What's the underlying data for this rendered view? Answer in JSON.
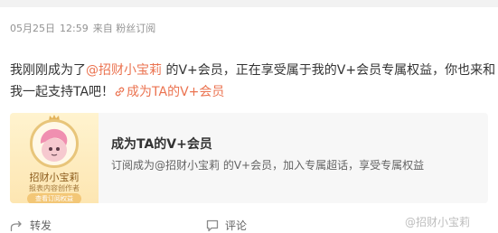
{
  "post": {
    "date": "05月25日",
    "time": "12:59",
    "source": "来自 粉丝订阅",
    "text": {
      "prefix": "我刚刚成为了",
      "mention": "@招财小宝莉",
      "middle": " 的V+会员，正在享受属于我的V+会员专属权益，你也来和",
      "line2": "我一起支持TA吧！",
      "link": "成为TA的V+会员"
    }
  },
  "card": {
    "title": "成为TA的V+会员",
    "description": "订阅成为@招财小宝莉 的V+会员，加入专属超话，享受专属权益",
    "thumb_name": "招财小宝莉",
    "thumb_tag": "报表内容创作者",
    "thumb_button": "查看订阅权益"
  },
  "actions": {
    "repost": "转发",
    "comment": "评论"
  },
  "watermark": "@招财小宝莉",
  "colors": {
    "accent": "#eb7350",
    "meta": "#939393",
    "card_bg": "#f7f7f7"
  },
  "icons": [
    "link-icon",
    "repost-icon",
    "comment-icon"
  ]
}
